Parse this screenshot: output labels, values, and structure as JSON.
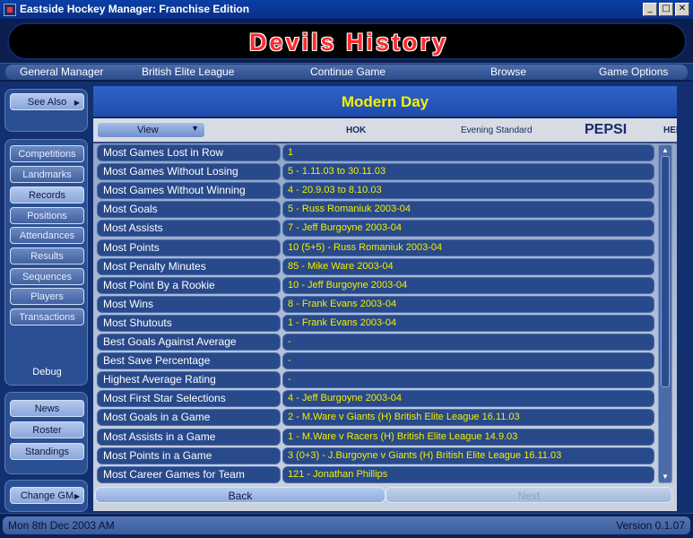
{
  "window": {
    "title": "Eastside Hockey Manager: Franchise Edition",
    "minimize": "_",
    "maximize": "□",
    "close": "✕"
  },
  "header": {
    "title": "Devils History"
  },
  "topmenu": [
    "General Manager",
    "British Elite League",
    "Continue Game",
    "Browse",
    "Game Options"
  ],
  "sidebar": {
    "see_also": "See Also",
    "items": [
      "Competitions",
      "Landmarks",
      "Records",
      "Positions",
      "Attendances",
      "Results",
      "Sequences",
      "Players",
      "Transactions"
    ],
    "active_item": "Records",
    "debug": "Debug",
    "bottom_items": [
      "News",
      "Roster",
      "Standings"
    ],
    "change_gm": "Change GM"
  },
  "content": {
    "section_title": "Modern Day",
    "view_label": "View",
    "ads": [
      "HOK",
      "Evening Standard",
      "PEPSI",
      "HER"
    ],
    "records": [
      {
        "label": "Most Games Lost in Row",
        "value": "1"
      },
      {
        "label": "Most Games Without Losing",
        "value": "5 - 1.11.03 to 30.11.03"
      },
      {
        "label": "Most Games Without Winning",
        "value": "4 - 20.9.03 to 8.10.03"
      },
      {
        "label": "Most Goals",
        "value": "5 - Russ Romaniuk 2003-04"
      },
      {
        "label": "Most Assists",
        "value": "7 - Jeff Burgoyne 2003-04"
      },
      {
        "label": "Most Points",
        "value": "10 (5+5) - Russ Romaniuk 2003-04"
      },
      {
        "label": "Most Penalty Minutes",
        "value": "85 - Mike Ware 2003-04"
      },
      {
        "label": "Most Point By a Rookie",
        "value": "10 - Jeff Burgoyne 2003-04"
      },
      {
        "label": "Most Wins",
        "value": "8 - Frank Evans 2003-04"
      },
      {
        "label": "Most Shutouts",
        "value": "1 - Frank Evans 2003-04"
      },
      {
        "label": "Best Goals Against Average",
        "value": "-"
      },
      {
        "label": "Best Save Percentage",
        "value": "-"
      },
      {
        "label": "Highest Average Rating",
        "value": "-"
      },
      {
        "label": "Most First Star Selections",
        "value": "4 - Jeff Burgoyne 2003-04"
      },
      {
        "label": "Most Goals in a Game",
        "value": "2 - M.Ware v Giants (H) British Elite League 16.11.03"
      },
      {
        "label": "Most Assists in a Game",
        "value": "1 - M.Ware v Racers (H) British Elite League 14.9.03"
      },
      {
        "label": "Most Points in a Game",
        "value": "3 (0+3) - J.Burgoyne v Giants (H) British Elite League 16.11.03"
      },
      {
        "label": "Most Career Games for Team",
        "value": "121 - Jonathan Phillips"
      }
    ],
    "back": "Back",
    "next": "Next"
  },
  "status": {
    "date": "Mon 8th Dec 2003 AM",
    "version": "Version 0.1.07"
  }
}
